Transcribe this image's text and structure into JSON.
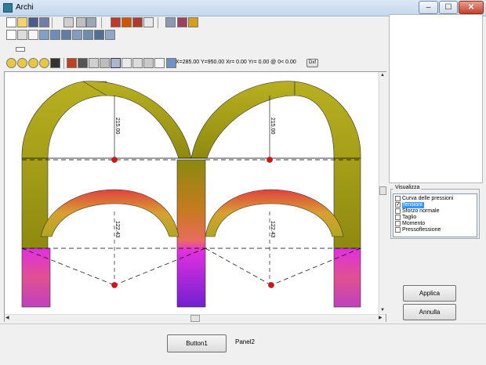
{
  "window": {
    "title": "Archi",
    "min_glyph": "–",
    "max_glyph": "☐",
    "close_glyph": "✕"
  },
  "toolbar1": [
    "new-icon",
    "open-icon",
    "save-icon",
    "save-as-icon",
    "copy-icon",
    "paste-icon",
    "tree-icon",
    "vault-icon",
    "arch-icon",
    "beam-icon",
    "frame-icon",
    "export-icon",
    "table-icon",
    "filter-icon"
  ],
  "toolbar2": [
    "page-icon",
    "scale-icon",
    "delete-icon",
    "chart-icon",
    "grid-icon",
    "node-icon",
    "element-icon",
    "layer-icon",
    "mirror-icon",
    "print-icon"
  ],
  "toolbar3": [
    "ruler-icon"
  ],
  "view_toolbar": {
    "icons": [
      "zoom-fit-icon",
      "zoom-in-icon",
      "zoom-out-icon",
      "zoom-window-icon",
      "pan-icon",
      "color-icon",
      "print-preview-icon",
      "grid-small-icon",
      "grid-icon",
      "grid-large-icon",
      "snap-icon",
      "nodes-icon",
      "dims-icon",
      "cursor-icon",
      "export-image-icon"
    ],
    "coords": "X=285.00 Y=950.00 Xr= 0.00 Yr= 0.00 @ 0< 0.00",
    "dxf_label": "Dxf"
  },
  "drawing": {
    "dim_top_left": "215.00",
    "dim_top_right": "215.00",
    "dim_bottom_left": "122.43",
    "dim_bottom_right": "122.43"
  },
  "visualizza": {
    "title": "Visualizza",
    "items": [
      {
        "label": "Curva delle pressioni",
        "checked": false,
        "selected": false
      },
      {
        "label": "Tensioni",
        "checked": true,
        "selected": true
      },
      {
        "label": "Sforzo normale",
        "checked": false,
        "selected": false
      },
      {
        "label": "Taglio",
        "checked": false,
        "selected": false
      },
      {
        "label": "Momento",
        "checked": false,
        "selected": false
      },
      {
        "label": "Pressoflessione",
        "checked": false,
        "selected": false
      }
    ]
  },
  "buttons": {
    "applica": "Applica",
    "annulla": "Annulla",
    "button1": "Button1"
  },
  "panel2": "Panel2"
}
